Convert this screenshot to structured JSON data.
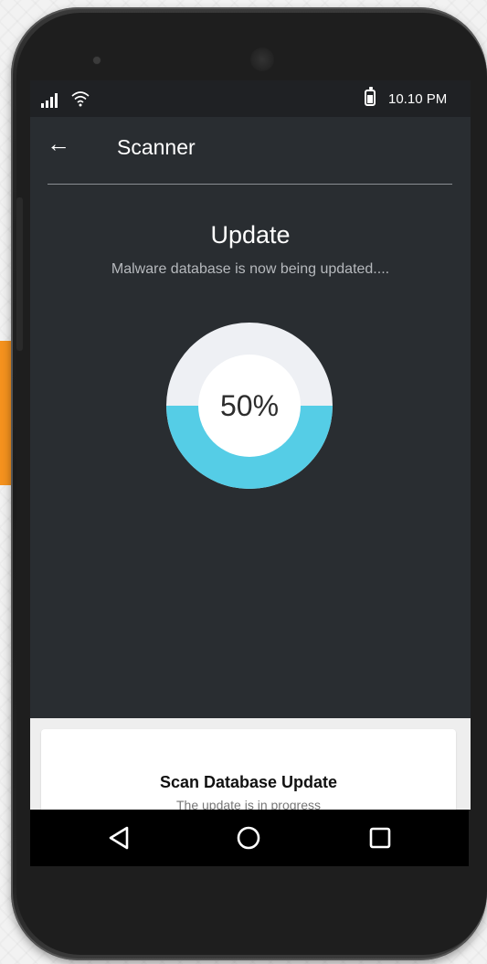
{
  "status_bar": {
    "time": "10.10 PM",
    "signal_icon": "signal-icon",
    "wifi_icon": "wifi-icon",
    "battery_icon": "battery-icon"
  },
  "app_bar": {
    "back_icon": "back-arrow-icon",
    "title": "Scanner"
  },
  "update": {
    "title": "Update",
    "subtitle": "Malware database is now being updated....",
    "progress_label": "50%",
    "progress_fraction": 0.5,
    "colors": {
      "progress": "#55cde6",
      "track": "#eef0f4",
      "center": "#ffffff"
    }
  },
  "card": {
    "title": "Scan Database Update",
    "subtitle": "The update is in progress"
  },
  "nav_bar": {
    "back_icon": "nav-back-icon",
    "home_icon": "nav-home-icon",
    "recent_icon": "nav-recent-icon"
  },
  "colors": {
    "screen_bg": "#292d31",
    "status_bg": "#1f2124",
    "accent_orange": "#f5921e"
  }
}
